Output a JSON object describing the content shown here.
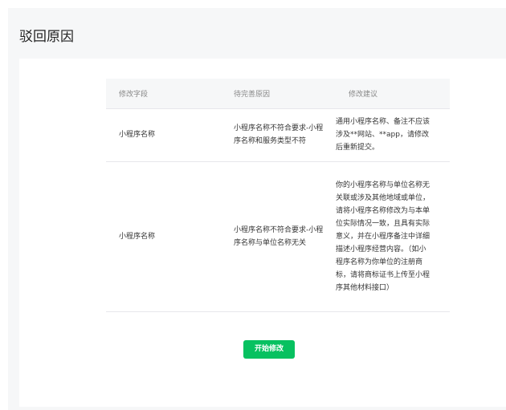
{
  "page": {
    "title": "驳回原因"
  },
  "table": {
    "headers": [
      "修改字段",
      "待完善原因",
      "修改建议"
    ],
    "rows": [
      {
        "field": "小程序名称",
        "reason": "小程序名称不符合要求-小程序名称和服务类型不符",
        "suggestion": "通用小程序名称、备注不应该涉及**网站、**app，请修改后重新提交。"
      },
      {
        "field": "小程序名称",
        "reason": "小程序名称不符合要求-小程序名称与单位名称无关",
        "suggestion": "你的小程序名称与单位名称无关联或涉及其他地域或单位，请将小程序名称修改为与本单位实际情况一致，且具有实际意义，并在小程序备注中详细描述小程序经营内容。（如小程序名称为你单位的注册商标，请将商标证书上传至小程序其他材料接口）"
      }
    ]
  },
  "actions": {
    "start_label": "开始修改"
  },
  "colors": {
    "primary": "#07c160",
    "panel_bg": "#f6f7f8",
    "header_text": "#888888",
    "border": "#e7e7eb"
  }
}
